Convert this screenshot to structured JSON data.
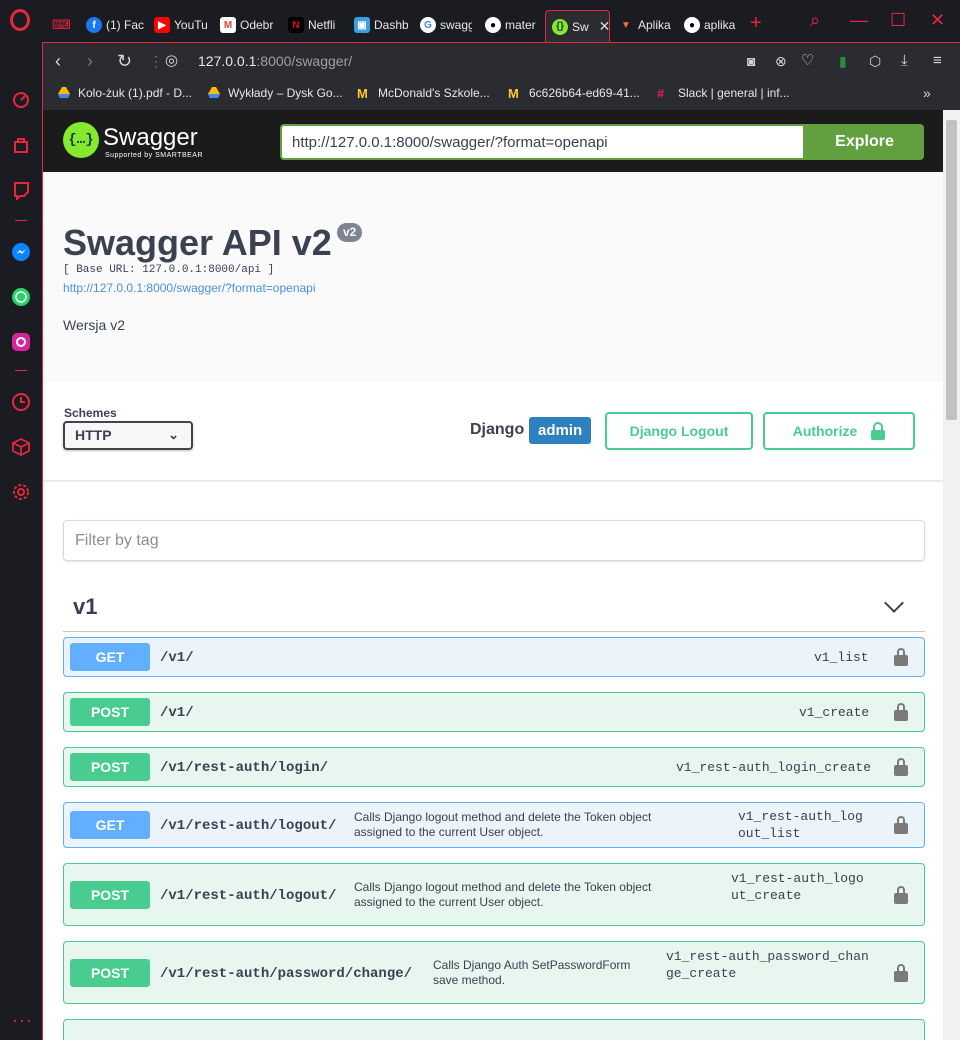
{
  "browser": {
    "tabs": [
      {
        "label": "(1) Fac",
        "icon": "facebook-icon",
        "color": "#1877f2"
      },
      {
        "label": "YouTu",
        "icon": "youtube-icon",
        "color": "#ff0000"
      },
      {
        "label": "Odebr",
        "icon": "gmail-icon",
        "color": "#ea4335"
      },
      {
        "label": "Netfli",
        "icon": "netflix-icon",
        "color": "#e50914"
      },
      {
        "label": "Dashb",
        "icon": "dashboard-icon",
        "color": "#3aa0e0"
      },
      {
        "label": "swagg",
        "icon": "google-icon",
        "color": "#4285f4"
      },
      {
        "label": "mater",
        "icon": "github-icon",
        "color": "#ffffff"
      },
      {
        "label": "Sw",
        "icon": "swagger-icon",
        "color": "#85ea2d"
      },
      {
        "label": "Aplika",
        "icon": "gitlab-icon",
        "color": "#fc6d26"
      },
      {
        "label": "aplika",
        "icon": "github-icon",
        "color": "#ffffff"
      }
    ],
    "url_host": "127.0.0.1",
    "url_port_path": ":8000/swagger/",
    "bookmarks": [
      {
        "label": "Kolo-żuk (1).pdf - D...",
        "icon": "google-drive-icon"
      },
      {
        "label": "Wykłady – Dysk Go...",
        "icon": "google-drive-icon"
      },
      {
        "label": "McDonald's Szkole...",
        "icon": "mcdonalds-icon"
      },
      {
        "label": "6c626b64-ed69-41...",
        "icon": "mcdonalds-icon"
      },
      {
        "label": "Slack | general | inf...",
        "icon": "slack-icon"
      }
    ],
    "accent": "#e8263c"
  },
  "swagger": {
    "logo_text": "Swagger",
    "logo_sub": "Supported by SMARTBEAR",
    "spec_url": "http://127.0.0.1:8000/swagger/?format=openapi",
    "explore_label": "Explore",
    "title": "Swagger API v2",
    "version": "v2",
    "base_url": "[ Base URL: 127.0.0.1:8000/api ]",
    "spec_link": "http://127.0.0.1:8000/swagger/?format=openapi",
    "description": "Wersja v2",
    "schemes_label": "Schemes",
    "scheme_selected": "HTTP",
    "django_label": "Django",
    "django_user": "admin",
    "django_logout_label": "Django Logout",
    "authorize_label": "Authorize",
    "filter_placeholder": "Filter by tag",
    "tag_name": "v1",
    "operations": [
      {
        "method": "GET",
        "path": "/v1/",
        "summary": "",
        "id": "v1_list"
      },
      {
        "method": "POST",
        "path": "/v1/",
        "summary": "",
        "id": "v1_create"
      },
      {
        "method": "POST",
        "path": "/v1/rest-auth/login/",
        "summary": "",
        "id": "v1_rest-auth_login_create"
      },
      {
        "method": "GET",
        "path": "/v1/rest-auth/logout/",
        "summary": "Calls Django logout method and delete the Token object assigned to the current User object.",
        "id": "v1_rest-auth_logout_list"
      },
      {
        "method": "POST",
        "path": "/v1/rest-auth/logout/",
        "summary": "Calls Django logout method and delete the Token object assigned to the current User object.",
        "id": "v1_rest-auth_logout_create"
      },
      {
        "method": "POST",
        "path": "/v1/rest-auth/password/change/",
        "summary": "Calls Django Auth SetPasswordForm save method.",
        "id": "v1_rest-auth_password_change_create"
      }
    ]
  }
}
